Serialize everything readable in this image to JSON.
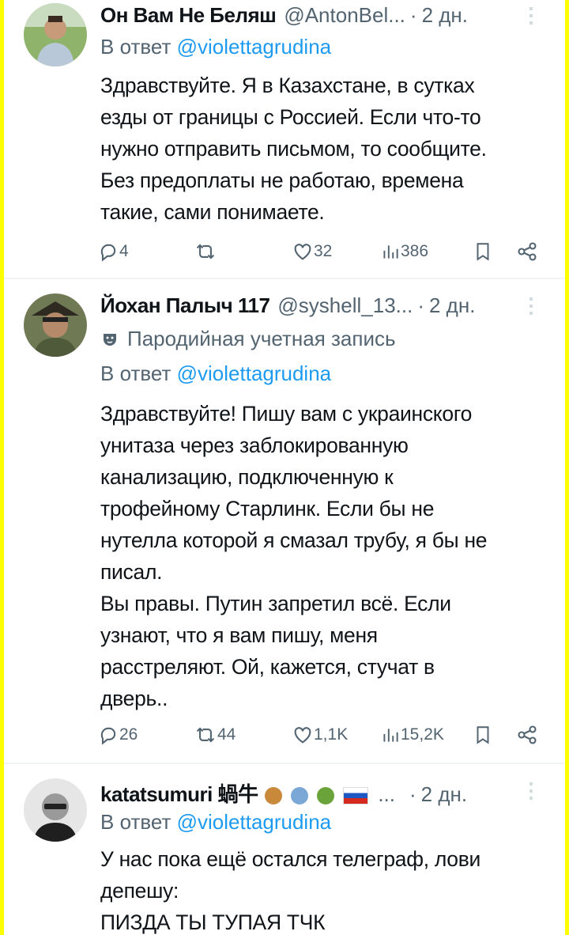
{
  "tweets": [
    {
      "name": "Он Вам Не Беляш",
      "handle": "@AntonBel...",
      "time": "2 дн.",
      "reply_prefix": "В ответ",
      "reply_to": "@violettagrudina",
      "text": "Здравствуйте. Я в Казахстане, в сутках\nезды от границы с Россией. Если что-то\nнужно отправить письмом, то сообщите.\nБез предоплаты не работаю, времена\nтакие, сами понимаете.",
      "stats": {
        "replies": "4",
        "reposts": "",
        "likes": "32",
        "views": "386"
      }
    },
    {
      "name": "Йохан Палыч 117",
      "handle": "@syshell_13...",
      "time": "2 дн.",
      "parody_label": "Пародийная учетная запись",
      "reply_prefix": "В ответ",
      "reply_to": "@violettagrudina",
      "text": "Здравствуйте! Пишу вам с украинского\nунитаза через заблокированную\nканализацию, подключенную к\nтрофейному Старлинк. Если бы не\nнутелла которой я смазал трубу, я бы не\nписал.\nВы правы. Путин запретил всё. Если\nузнают, что я вам пишу, меня\nрасстреляют. Ой, кажется, стучат в\nдверь..",
      "stats": {
        "replies": "26",
        "reposts": "44",
        "likes": "1,1K",
        "views": "15,2K"
      }
    },
    {
      "name": "katatsumuri 蝸牛",
      "ellipsis": "...",
      "time": "2 дн.",
      "reply_prefix": "В ответ",
      "reply_to": "@violettagrudina",
      "text": "У нас пока ещё остался телеграф, лови\nдепешу:\nПИЗДА ТЫ ТУПАЯ ТЧК"
    }
  ],
  "separator": "·",
  "icons": [
    "more-icon",
    "reply-icon",
    "repost-icon",
    "like-icon",
    "views-icon",
    "bookmark-icon",
    "share-icon",
    "parody-mask-icon"
  ],
  "colors": {
    "accent": "#1d9bf0",
    "secondary": "#536471",
    "border": "#ffff00"
  }
}
